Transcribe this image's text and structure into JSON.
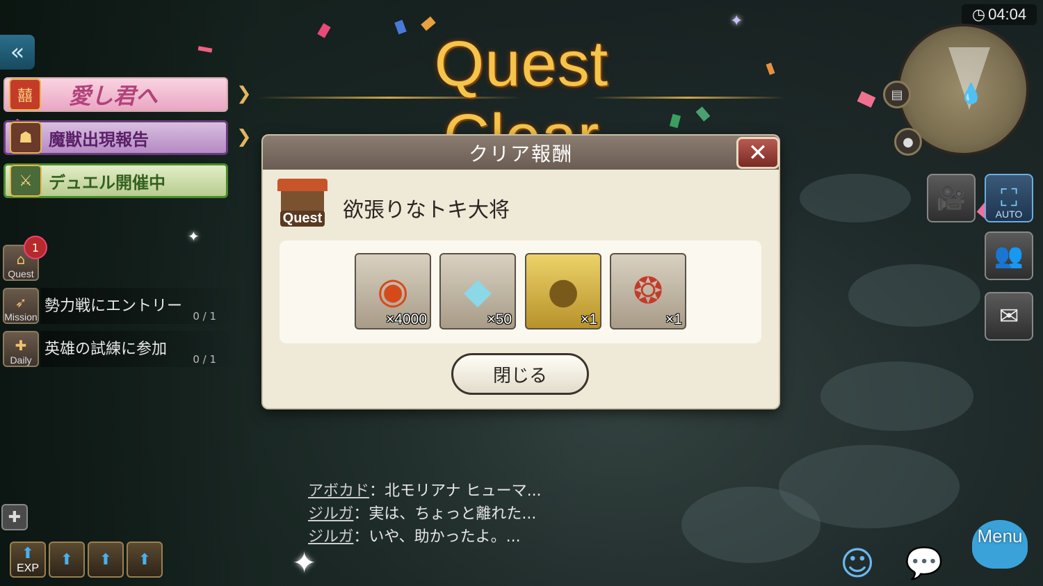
{
  "title": "Quest Clear",
  "left_banners": {
    "love_label": "愛し君へ",
    "beast_label": "魔獣出現報告",
    "duel_label": "デュエル開催中"
  },
  "side_icons": {
    "quest_label": "Quest",
    "quest_badge": "1",
    "mission_label": "Mission",
    "daily_label": "Daily"
  },
  "missions": [
    {
      "title": "勢力戦にエントリー",
      "progress": "0 / 1"
    },
    {
      "title": "英雄の試練に参加",
      "progress": "0 / 1"
    }
  ],
  "modal": {
    "title": "クリア報酬",
    "quest_icon_label": "Quest",
    "quest_name": "欲張りなトキ大将",
    "rewards": [
      {
        "icon": "red-knot-coin-icon",
        "qty": "×4000"
      },
      {
        "icon": "rainbow-gem-icon",
        "qty": "×50"
      },
      {
        "icon": "golden-orb-icon",
        "qty": "×1"
      },
      {
        "icon": "fortune-emblem-icon",
        "qty": "×1"
      }
    ],
    "close_label": "閉じる"
  },
  "hud": {
    "clock": "04:04",
    "auto_label": "AUTO",
    "menu_label": "Menu"
  },
  "chat": [
    {
      "who": "アボカド",
      "text": "：北モリアナ ヒューマ..."
    },
    {
      "who": "ジルガ",
      "text": "：実は、ちょっと離れた..."
    },
    {
      "who": "ジルガ",
      "text": "：いや、助かったよ。..."
    }
  ],
  "buffs": [
    {
      "label": "EXP"
    },
    {
      "label": ""
    },
    {
      "label": ""
    },
    {
      "label": ""
    }
  ],
  "colors": {
    "title_gold": "#f4c54a",
    "modal_bg": "#efe9d8",
    "modal_header": "#7a6c62",
    "close_red": "#9a3a33"
  }
}
